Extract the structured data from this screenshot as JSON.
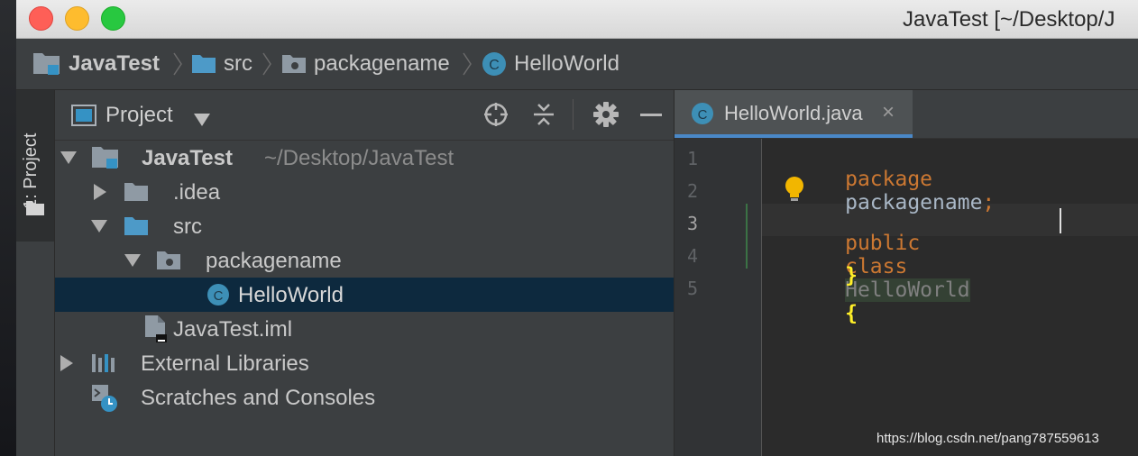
{
  "window": {
    "title": "JavaTest [~/Desktop/J"
  },
  "breadcrumb": {
    "items": [
      {
        "label": "JavaTest",
        "icon": "project-folder-icon"
      },
      {
        "label": "src",
        "icon": "folder-icon"
      },
      {
        "label": "packagename",
        "icon": "package-icon"
      },
      {
        "label": "HelloWorld",
        "icon": "class-icon"
      }
    ]
  },
  "tool_window_stripe": {
    "project_tab_label": "1: Project"
  },
  "project_panel": {
    "title": "Project",
    "toolbar_icons": [
      "locate-icon",
      "collapse-all-icon",
      "gear-icon",
      "hide-icon"
    ],
    "tree": [
      {
        "label": "JavaTest",
        "secondary": "~/Desktop/JavaTest",
        "expanded": true,
        "icon": "project-folder-icon"
      },
      {
        "label": ".idea",
        "expanded": false,
        "icon": "folder-icon"
      },
      {
        "label": "src",
        "expanded": true,
        "icon": "source-folder-icon"
      },
      {
        "label": "packagename",
        "expanded": true,
        "icon": "package-icon"
      },
      {
        "label": "HelloWorld",
        "selected": true,
        "icon": "class-icon"
      },
      {
        "label": "JavaTest.iml",
        "icon": "iml-file-icon"
      },
      {
        "label": "External Libraries",
        "expanded": false,
        "icon": "libraries-icon"
      },
      {
        "label": "Scratches and Consoles",
        "icon": "scratches-icon"
      }
    ]
  },
  "editor": {
    "tab_label": "HelloWorld.java",
    "close_glyph": "×",
    "line_numbers": [
      "1",
      "2",
      "3",
      "4",
      "5"
    ],
    "current_line": 3,
    "code": {
      "line1_keyword": "package",
      "line1_name": "packagename",
      "line1_semicolon": ";",
      "line3_public": "public",
      "line3_class": "class",
      "line3_name": "HelloWorld",
      "line3_brace": "{",
      "line4_brace": "}"
    }
  },
  "colors": {
    "accent": "#4a88c7",
    "selection": "#0d293e",
    "keyword": "#cc7832",
    "class_icon": "#3d8fb6"
  },
  "watermark": "https://blog.csdn.net/pang787559613"
}
